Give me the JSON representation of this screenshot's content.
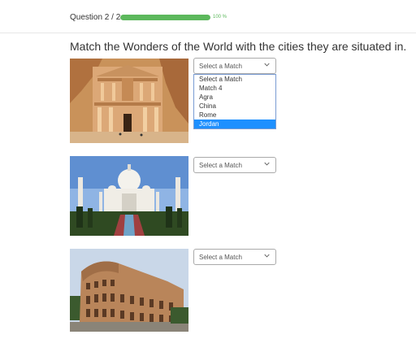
{
  "header": {
    "question_label": "Question 2 / 2",
    "progress_percent": 100,
    "progress_text": "100 %",
    "progress_color": "#5cb85c"
  },
  "question": {
    "title": "Match the Wonders of the World with the cities they are situated in."
  },
  "items": [
    {
      "image_icon": "petra-treasury-image",
      "select_value": "Select a Match",
      "dropdown_open": true
    },
    {
      "image_icon": "taj-mahal-image",
      "select_value": "Select a Match"
    },
    {
      "image_icon": "colosseum-image",
      "select_value": "Select a Match"
    }
  ],
  "dropdown": {
    "options": [
      "Select a Match",
      "Match 4",
      "Agra",
      "China",
      "Rome",
      "Jordan"
    ],
    "highlighted": "Jordan",
    "highlight_color": "#1e90ff"
  }
}
